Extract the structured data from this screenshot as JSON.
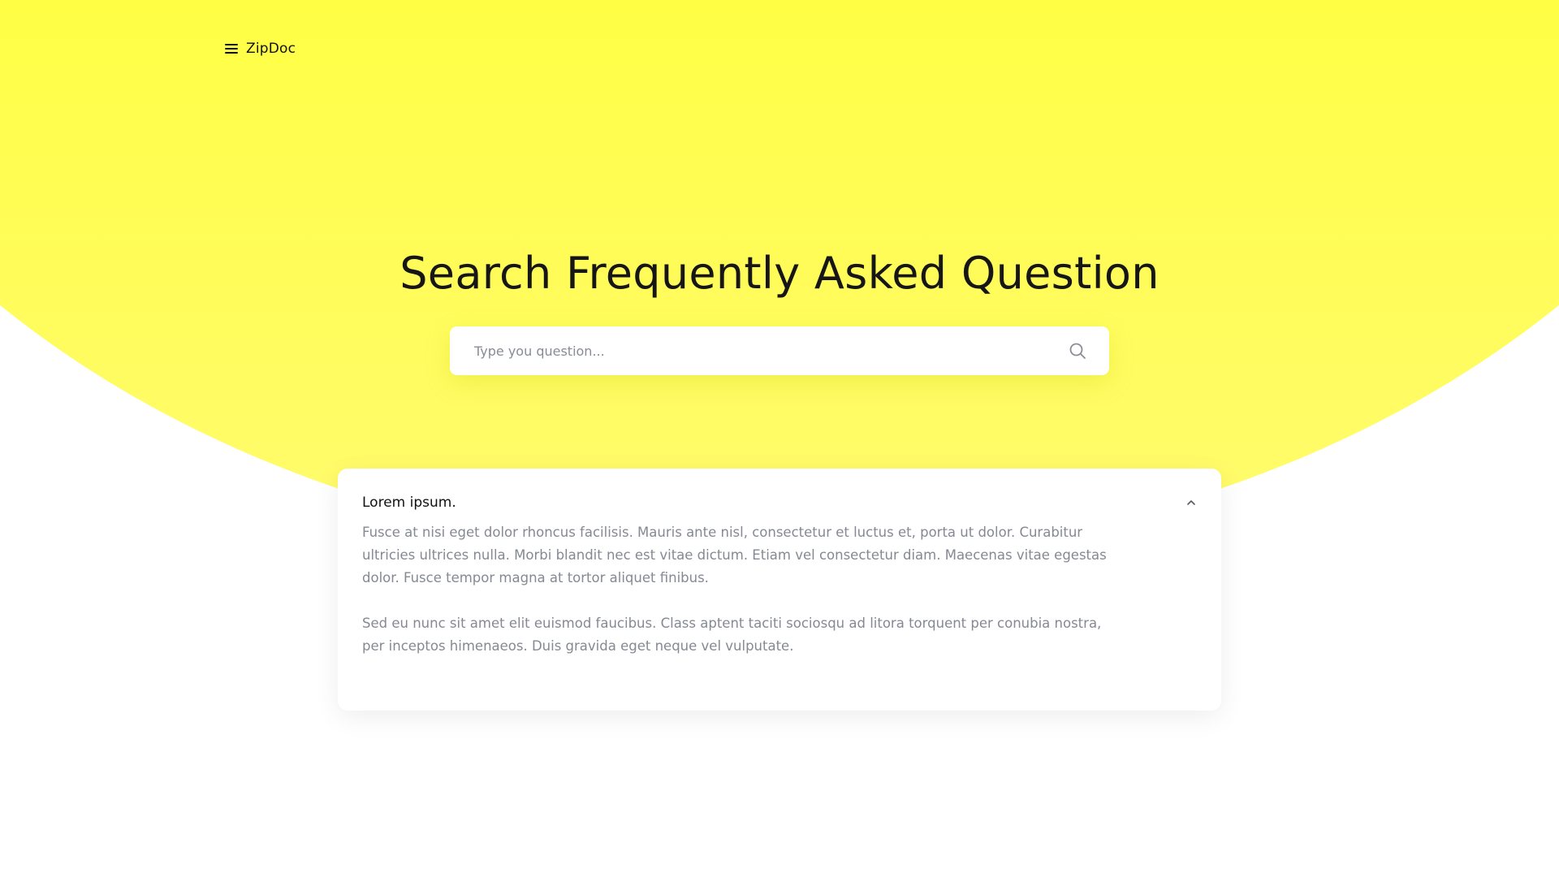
{
  "header": {
    "menu_icon": "hamburger-menu-icon",
    "brand": "ZipDoc"
  },
  "hero": {
    "title": "Search Frequently Asked Question",
    "background_color": "#ffff33"
  },
  "search": {
    "placeholder": "Type you question...",
    "value": "",
    "icon": "search-icon"
  },
  "faq": {
    "items": [
      {
        "question": "Lorem ipsum.",
        "expanded": true,
        "toggle_icon": "chevron-up-icon",
        "answer_paragraphs": [
          "Fusce at nisi eget dolor rhoncus facilisis. Mauris ante nisl, consectetur et luctus et, porta ut dolor. Curabitur ultricies ultrices nulla. Morbi blandit nec est vitae dictum. Etiam vel consectetur diam. Maecenas vitae egestas dolor. Fusce tempor magna at tortor aliquet finibus.",
          "Sed eu nunc sit amet elit euismod faucibus. Class aptent taciti sociosqu ad litora torquent per conubia nostra, per inceptos himenaeos. Duis gravida eget neque vel vulputate."
        ]
      }
    ]
  }
}
